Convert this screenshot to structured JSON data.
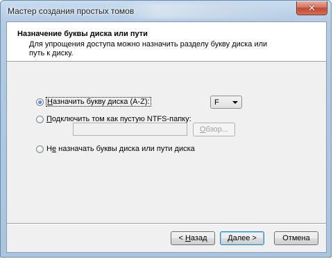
{
  "window": {
    "title": "Мастер создания простых томов",
    "close_glyph": "✕"
  },
  "header": {
    "title": "Назначение буквы диска или пути",
    "subtitle": "Для упрощения доступа можно назначить разделу букву диска или путь к диску."
  },
  "options": {
    "assign_letter": {
      "access_key": "Н",
      "rest": "азначить букву диска (A-Z):",
      "checked": true
    },
    "mount_folder": {
      "access_key": "П",
      "rest": "одключить том как пустую NTFS-папку:",
      "checked": false
    },
    "none": {
      "prefix": "Н",
      "access_key": "е",
      "rest": " назначать буквы диска или пути диска",
      "checked": false
    }
  },
  "drive_letter": {
    "selected": "F"
  },
  "folder_path": {
    "value": ""
  },
  "browse_button": {
    "access_key": "О",
    "rest": "бзор..."
  },
  "footer": {
    "back": {
      "prefix": "< ",
      "access_key": "Н",
      "rest": "азад"
    },
    "next": {
      "access_key": "Д",
      "rest": "алее >"
    },
    "cancel": {
      "label": "Отмена"
    }
  },
  "colors": {
    "frame": "#b3cbe3",
    "client_bg": "#f0f0f0",
    "close_button": "#c24a35",
    "default_button_border": "#3c7fb1"
  }
}
